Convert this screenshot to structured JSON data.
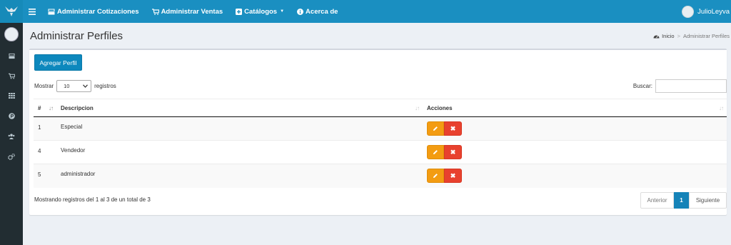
{
  "topbar": {
    "nav": [
      {
        "label": "Administrar Cotizaciones",
        "icon": "cashregister-icon"
      },
      {
        "label": "Administrar Ventas",
        "icon": "cart-icon"
      },
      {
        "label": "Catálogos",
        "icon": "plus-square-icon",
        "dropdown": true
      },
      {
        "label": "Acerca de",
        "icon": "info-circle-icon"
      }
    ],
    "user_name": "JulioLeyva"
  },
  "sidebar": {
    "icons": [
      "cashregister-icon",
      "cart-icon",
      "grid-icon",
      "product-icon",
      "users-icon",
      "gears-icon"
    ]
  },
  "header": {
    "title": "Administrar Perfiles",
    "breadcrumb_home": "Inicio",
    "breadcrumb_current": "Administrar Perfiles"
  },
  "box": {
    "add_button": "Agregar Perfil",
    "length_prefix": "Mostrar",
    "length_value": "10",
    "length_suffix": "registros",
    "search_label": "Buscar:",
    "search_value": ""
  },
  "table": {
    "columns": [
      "#",
      "Descripcion",
      "Acciones"
    ],
    "rows": [
      {
        "id": "1",
        "desc": "Especial"
      },
      {
        "id": "4",
        "desc": "Vendedor"
      },
      {
        "id": "5",
        "desc": "administrador"
      }
    ]
  },
  "footer": {
    "info": "Mostrando registros del 1 al 3 de un total de 3",
    "prev": "Anterior",
    "page": "1",
    "next": "Siguiente"
  },
  "colors": {
    "topbar": "#1a8fc1",
    "sidebar": "#222d32",
    "primary": "#0d88bd",
    "edit": "#f39c12",
    "delete": "#e8412e"
  }
}
